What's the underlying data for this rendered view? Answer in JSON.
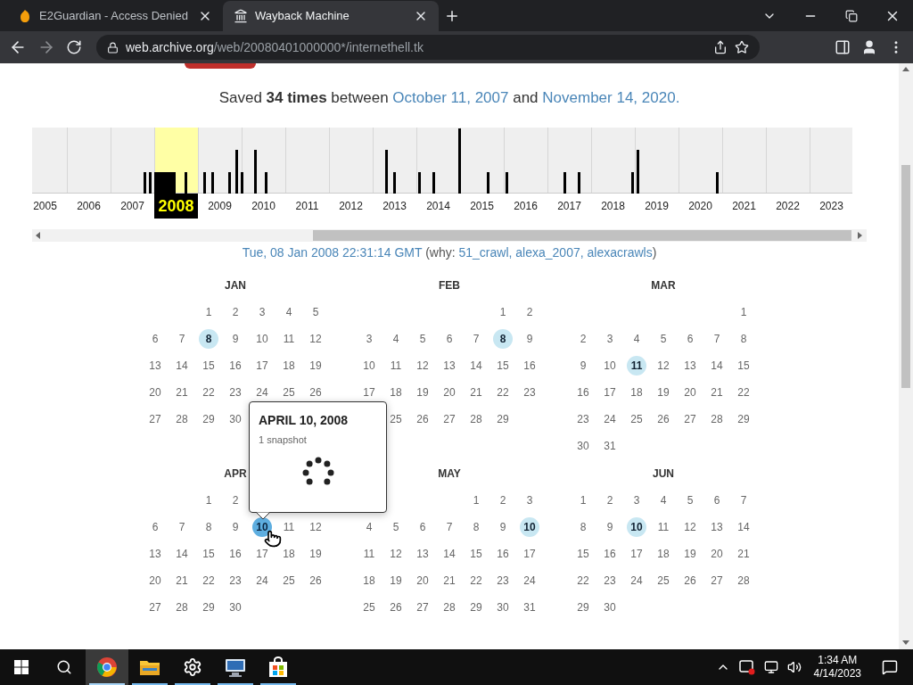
{
  "browser": {
    "tabs": [
      {
        "title": "E2Guardian - Access Denied",
        "selected": false
      },
      {
        "title": "Wayback Machine",
        "selected": true
      }
    ],
    "url": {
      "domain": "web.archive.org",
      "path": "/web/20080401000000*/internethell.tk"
    }
  },
  "summary": {
    "before": "Saved **34 times** between",
    "first_link": "October 11, 2007",
    "middle": "and",
    "last_link": "November 14, 2020."
  },
  "timeline": {
    "years": [
      {
        "label": "2005",
        "selected": false
      },
      {
        "label": "2006",
        "selected": false
      },
      {
        "label": "2007",
        "selected": false
      },
      {
        "label": "2008",
        "selected": true
      },
      {
        "label": "2009",
        "selected": false
      },
      {
        "label": "2010",
        "selected": false
      },
      {
        "label": "2011",
        "selected": false
      },
      {
        "label": "2012",
        "selected": false
      },
      {
        "label": "2013",
        "selected": false
      },
      {
        "label": "2014",
        "selected": false
      },
      {
        "label": "2015",
        "selected": false
      },
      {
        "label": "2016",
        "selected": false
      },
      {
        "label": "2017",
        "selected": false
      },
      {
        "label": "2018",
        "selected": false
      },
      {
        "label": "2019",
        "selected": false
      },
      {
        "label": "2020",
        "selected": false
      },
      {
        "label": "2021",
        "selected": false
      },
      {
        "label": "2022",
        "selected": false
      },
      {
        "label": "2023",
        "selected": false
      }
    ]
  },
  "capture": {
    "timestamp": "Tue, 08 Jan 2008 22:31:14 GMT",
    "why_open": "(why:",
    "reasons": [
      "51_crawl,",
      "alexa_2007,",
      "alexacrawls"
    ],
    "close": ")"
  },
  "calendar": {
    "months": [
      {
        "name": "JAN",
        "weeks": [
          [
            {
              "kind": "blank"
            },
            {
              "kind": "blank"
            },
            {
              "day": "1",
              "kind": "plain"
            },
            {
              "day": "2",
              "kind": "plain"
            },
            {
              "day": "3",
              "kind": "plain"
            },
            {
              "day": "4",
              "kind": "plain"
            },
            {
              "day": "5",
              "kind": "plain"
            }
          ],
          [
            {
              "day": "6",
              "kind": "plain"
            },
            {
              "day": "7",
              "kind": "plain"
            },
            {
              "day": "8",
              "kind": "snapshot"
            },
            {
              "day": "9",
              "kind": "plain"
            },
            {
              "day": "10",
              "kind": "plain"
            },
            {
              "day": "11",
              "kind": "plain"
            },
            {
              "day": "12",
              "kind": "plain"
            }
          ],
          [
            {
              "day": "13",
              "kind": "plain"
            },
            {
              "day": "14",
              "kind": "plain"
            },
            {
              "day": "15",
              "kind": "plain"
            },
            {
              "day": "16",
              "kind": "plain"
            },
            {
              "day": "17",
              "kind": "plain"
            },
            {
              "day": "18",
              "kind": "plain"
            },
            {
              "day": "19",
              "kind": "plain"
            }
          ],
          [
            {
              "day": "20",
              "kind": "plain"
            },
            {
              "day": "21",
              "kind": "plain"
            },
            {
              "day": "22",
              "kind": "plain"
            },
            {
              "day": "23",
              "kind": "plain"
            },
            {
              "day": "24",
              "kind": "plain"
            },
            {
              "day": "25",
              "kind": "plain"
            },
            {
              "day": "26",
              "kind": "plain"
            }
          ],
          [
            {
              "day": "27",
              "kind": "plain"
            },
            {
              "day": "28",
              "kind": "plain"
            },
            {
              "day": "29",
              "kind": "plain"
            },
            {
              "day": "30",
              "kind": "plain"
            }
          ]
        ]
      },
      {
        "name": "FEB",
        "weeks": [
          [
            {
              "kind": "blank"
            },
            {
              "kind": "blank"
            },
            {
              "kind": "blank"
            },
            {
              "kind": "blank"
            },
            {
              "kind": "blank"
            },
            {
              "day": "1",
              "kind": "plain"
            },
            {
              "day": "2",
              "kind": "plain"
            }
          ],
          [
            {
              "day": "3",
              "kind": "plain"
            },
            {
              "day": "4",
              "kind": "plain"
            },
            {
              "day": "5",
              "kind": "plain"
            },
            {
              "day": "6",
              "kind": "plain"
            },
            {
              "day": "7",
              "kind": "plain"
            },
            {
              "day": "8",
              "kind": "snapshot"
            },
            {
              "day": "9",
              "kind": "plain"
            }
          ],
          [
            {
              "day": "10",
              "kind": "plain"
            },
            {
              "day": "11",
              "kind": "plain"
            },
            {
              "day": "12",
              "kind": "plain"
            },
            {
              "day": "13",
              "kind": "plain"
            },
            {
              "day": "14",
              "kind": "plain"
            },
            {
              "day": "15",
              "kind": "plain"
            },
            {
              "day": "16",
              "kind": "plain"
            }
          ],
          [
            {
              "day": "17",
              "kind": "plain"
            },
            {
              "day": "18",
              "kind": "plain"
            },
            {
              "day": "19",
              "kind": "plain"
            },
            {
              "day": "20",
              "kind": "plain"
            },
            {
              "day": "21",
              "kind": "plain"
            },
            {
              "day": "22",
              "kind": "plain"
            },
            {
              "day": "23",
              "kind": "plain"
            }
          ],
          [
            {
              "kind": "blank"
            },
            {
              "day": "25",
              "kind": "plain"
            },
            {
              "day": "26",
              "kind": "plain"
            },
            {
              "day": "27",
              "kind": "plain"
            },
            {
              "day": "28",
              "kind": "plain"
            },
            {
              "day": "29",
              "kind": "plain"
            }
          ]
        ]
      },
      {
        "name": "MAR",
        "weeks": [
          [
            {
              "kind": "blank"
            },
            {
              "kind": "blank"
            },
            {
              "kind": "blank"
            },
            {
              "kind": "blank"
            },
            {
              "kind": "blank"
            },
            {
              "kind": "blank"
            },
            {
              "day": "1",
              "kind": "plain"
            }
          ],
          [
            {
              "day": "2",
              "kind": "plain"
            },
            {
              "day": "3",
              "kind": "plain"
            },
            {
              "day": "4",
              "kind": "plain"
            },
            {
              "day": "5",
              "kind": "plain"
            },
            {
              "day": "6",
              "kind": "plain"
            },
            {
              "day": "7",
              "kind": "plain"
            },
            {
              "day": "8",
              "kind": "plain"
            }
          ],
          [
            {
              "day": "9",
              "kind": "plain"
            },
            {
              "day": "10",
              "kind": "plain"
            },
            {
              "day": "11",
              "kind": "snapshot"
            },
            {
              "day": "12",
              "kind": "plain"
            },
            {
              "day": "13",
              "kind": "plain"
            },
            {
              "day": "14",
              "kind": "plain"
            },
            {
              "day": "15",
              "kind": "plain"
            }
          ],
          [
            {
              "day": "16",
              "kind": "plain"
            },
            {
              "day": "17",
              "kind": "plain"
            },
            {
              "day": "18",
              "kind": "plain"
            },
            {
              "day": "19",
              "kind": "plain"
            },
            {
              "day": "20",
              "kind": "plain"
            },
            {
              "day": "21",
              "kind": "plain"
            },
            {
              "day": "22",
              "kind": "plain"
            }
          ],
          [
            {
              "day": "23",
              "kind": "plain"
            },
            {
              "day": "24",
              "kind": "plain"
            },
            {
              "day": "25",
              "kind": "plain"
            },
            {
              "day": "26",
              "kind": "plain"
            },
            {
              "day": "27",
              "kind": "plain"
            },
            {
              "day": "28",
              "kind": "plain"
            },
            {
              "day": "29",
              "kind": "plain"
            }
          ],
          [
            {
              "day": "30",
              "kind": "plain"
            },
            {
              "day": "31",
              "kind": "plain"
            }
          ]
        ]
      },
      {
        "name": "APR",
        "weeks": [
          [
            {
              "kind": "blank"
            },
            {
              "kind": "blank"
            },
            {
              "day": "1",
              "kind": "plain"
            },
            {
              "day": "2",
              "kind": "plain"
            }
          ],
          [
            {
              "day": "6",
              "kind": "plain"
            },
            {
              "day": "7",
              "kind": "plain"
            },
            {
              "day": "8",
              "kind": "plain"
            },
            {
              "day": "9",
              "kind": "plain"
            },
            {
              "day": "10",
              "kind": "hovered"
            },
            {
              "day": "11",
              "kind": "plain"
            },
            {
              "day": "12",
              "kind": "plain"
            }
          ],
          [
            {
              "day": "13",
              "kind": "plain"
            },
            {
              "day": "14",
              "kind": "plain"
            },
            {
              "day": "15",
              "kind": "plain"
            },
            {
              "day": "16",
              "kind": "plain"
            },
            {
              "day": "17",
              "kind": "plain"
            },
            {
              "day": "18",
              "kind": "plain"
            },
            {
              "day": "19",
              "kind": "plain"
            }
          ],
          [
            {
              "day": "20",
              "kind": "plain"
            },
            {
              "day": "21",
              "kind": "plain"
            },
            {
              "day": "22",
              "kind": "plain"
            },
            {
              "day": "23",
              "kind": "plain"
            },
            {
              "day": "24",
              "kind": "plain"
            },
            {
              "day": "25",
              "kind": "plain"
            },
            {
              "day": "26",
              "kind": "plain"
            }
          ],
          [
            {
              "day": "27",
              "kind": "plain"
            },
            {
              "day": "28",
              "kind": "plain"
            },
            {
              "day": "29",
              "kind": "plain"
            },
            {
              "day": "30",
              "kind": "plain"
            }
          ]
        ]
      },
      {
        "name": "MAY",
        "weeks": [
          [
            {
              "kind": "blank"
            },
            {
              "kind": "blank"
            },
            {
              "kind": "blank"
            },
            {
              "kind": "blank"
            },
            {
              "day": "1",
              "kind": "plain"
            },
            {
              "day": "2",
              "kind": "plain"
            },
            {
              "day": "3",
              "kind": "plain"
            }
          ],
          [
            {
              "day": "4",
              "kind": "plain"
            },
            {
              "day": "5",
              "kind": "plain"
            },
            {
              "day": "6",
              "kind": "plain"
            },
            {
              "day": "7",
              "kind": "plain"
            },
            {
              "day": "8",
              "kind": "plain"
            },
            {
              "day": "9",
              "kind": "plain"
            },
            {
              "day": "10",
              "kind": "snapshot"
            }
          ],
          [
            {
              "day": "11",
              "kind": "plain"
            },
            {
              "day": "12",
              "kind": "plain"
            },
            {
              "day": "13",
              "kind": "plain"
            },
            {
              "day": "14",
              "kind": "plain"
            },
            {
              "day": "15",
              "kind": "plain"
            },
            {
              "day": "16",
              "kind": "plain"
            },
            {
              "day": "17",
              "kind": "plain"
            }
          ],
          [
            {
              "day": "18",
              "kind": "plain"
            },
            {
              "day": "19",
              "kind": "plain"
            },
            {
              "day": "20",
              "kind": "plain"
            },
            {
              "day": "21",
              "kind": "plain"
            },
            {
              "day": "22",
              "kind": "plain"
            },
            {
              "day": "23",
              "kind": "plain"
            },
            {
              "day": "24",
              "kind": "plain"
            }
          ],
          [
            {
              "day": "25",
              "kind": "plain"
            },
            {
              "day": "26",
              "kind": "plain"
            },
            {
              "day": "27",
              "kind": "plain"
            },
            {
              "day": "28",
              "kind": "plain"
            },
            {
              "day": "29",
              "kind": "plain"
            },
            {
              "day": "30",
              "kind": "plain"
            },
            {
              "day": "31",
              "kind": "plain"
            }
          ]
        ]
      },
      {
        "name": "JUN",
        "weeks": [
          [
            {
              "day": "1",
              "kind": "plain"
            },
            {
              "day": "2",
              "kind": "plain"
            },
            {
              "day": "3",
              "kind": "plain"
            },
            {
              "day": "4",
              "kind": "plain"
            },
            {
              "day": "5",
              "kind": "plain"
            },
            {
              "day": "6",
              "kind": "plain"
            },
            {
              "day": "7",
              "kind": "plain"
            }
          ],
          [
            {
              "day": "8",
              "kind": "plain"
            },
            {
              "day": "9",
              "kind": "plain"
            },
            {
              "day": "10",
              "kind": "snapshot"
            },
            {
              "day": "11",
              "kind": "plain"
            },
            {
              "day": "12",
              "kind": "plain"
            },
            {
              "day": "13",
              "kind": "plain"
            },
            {
              "day": "14",
              "kind": "plain"
            }
          ],
          [
            {
              "day": "15",
              "kind": "plain"
            },
            {
              "day": "16",
              "kind": "plain"
            },
            {
              "day": "17",
              "kind": "plain"
            },
            {
              "day": "18",
              "kind": "plain"
            },
            {
              "day": "19",
              "kind": "plain"
            },
            {
              "day": "20",
              "kind": "plain"
            },
            {
              "day": "21",
              "kind": "plain"
            }
          ],
          [
            {
              "day": "22",
              "kind": "plain"
            },
            {
              "day": "23",
              "kind": "plain"
            },
            {
              "day": "24",
              "kind": "plain"
            },
            {
              "day": "25",
              "kind": "plain"
            },
            {
              "day": "26",
              "kind": "plain"
            },
            {
              "day": "27",
              "kind": "plain"
            },
            {
              "day": "28",
              "kind": "plain"
            }
          ],
          [
            {
              "day": "29",
              "kind": "plain"
            },
            {
              "day": "30",
              "kind": "plain"
            }
          ]
        ]
      }
    ],
    "tooltip": {
      "title": "APRIL 10, 2008",
      "subtitle": "1 snapshot"
    }
  },
  "taskbar": {
    "apps": [
      {
        "kind": "chrome",
        "selected": true
      },
      {
        "kind": "folder",
        "selected": false
      },
      {
        "kind": "settings",
        "selected": false
      },
      {
        "kind": "remote",
        "selected": false
      },
      {
        "kind": "store",
        "selected": false
      }
    ],
    "clock": {
      "time": "1:34 AM",
      "date": "4/14/2023"
    }
  }
}
